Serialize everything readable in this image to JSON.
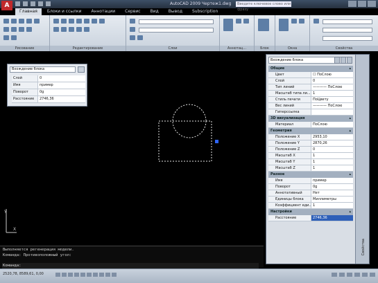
{
  "app": {
    "logo": "A",
    "title": "AutoCAD 2009  Чертеж1.dwg",
    "search_placeholder": "Введите ключевое слово или фразу"
  },
  "ribbon": {
    "tabs": [
      "Главная",
      "Блоки и ссылки",
      "Аннотации",
      "Сервис",
      "Вид",
      "Вывод",
      "Subscription"
    ],
    "active_tab": "Главная",
    "panels": [
      "Рисование",
      "Редактирование",
      "Слои",
      "Аннотац...",
      "Блок",
      "Окна",
      "Свойства"
    ]
  },
  "quick_props": {
    "selector": "Вхождение блока",
    "rows": [
      {
        "key": "Слой",
        "value": "0"
      },
      {
        "key": "Имя",
        "value": "пример"
      },
      {
        "key": "Поворот",
        "value": "0g"
      },
      {
        "key": "Расстояние",
        "value": "2746,36"
      }
    ]
  },
  "command_line": {
    "lines": [
      "Выполняется регенерация модели.",
      "Команда: Противоположный угол:"
    ],
    "prompt": "Команда:"
  },
  "status": {
    "coords": "2520,78, 8589,61, 0,00"
  },
  "properties": {
    "selector": "Вхождение блока",
    "sections": [
      {
        "title": "Общие",
        "rows": [
          {
            "key": "Цвет",
            "value": "☐ ПоСлою"
          },
          {
            "key": "Слой",
            "value": "0"
          },
          {
            "key": "Тип линий",
            "value": "———— ПоСлою"
          },
          {
            "key": "Масштаб типа ли...",
            "value": "1"
          },
          {
            "key": "Стиль печати",
            "value": "ПоЦвету"
          },
          {
            "key": "Вес линий",
            "value": "———— ПоСлою"
          },
          {
            "key": "Гиперссылка",
            "value": ""
          }
        ]
      },
      {
        "title": "3D визуализация",
        "rows": [
          {
            "key": "Материал",
            "value": "ПоСлою"
          }
        ]
      },
      {
        "title": "Геометрия",
        "rows": [
          {
            "key": "Положение X",
            "value": "2953,10"
          },
          {
            "key": "Положение Y",
            "value": "2870,26"
          },
          {
            "key": "Положение Z",
            "value": "0"
          },
          {
            "key": "Масштаб X",
            "value": "1"
          },
          {
            "key": "Масштаб Y",
            "value": "1"
          },
          {
            "key": "Масштаб Z",
            "value": "1"
          }
        ]
      },
      {
        "title": "Разное",
        "rows": [
          {
            "key": "Имя",
            "value": "пример"
          },
          {
            "key": "Поворот",
            "value": "0g"
          },
          {
            "key": "Аннотативный",
            "value": "Нет"
          },
          {
            "key": "Единицы блока",
            "value": "Миллиметры"
          },
          {
            "key": "Коэффициент еди...",
            "value": "1"
          }
        ]
      },
      {
        "title": "Настройки",
        "rows": [
          {
            "key": "Расстояние",
            "value": "2746,36"
          }
        ]
      }
    ],
    "side_label": "Свойства"
  }
}
